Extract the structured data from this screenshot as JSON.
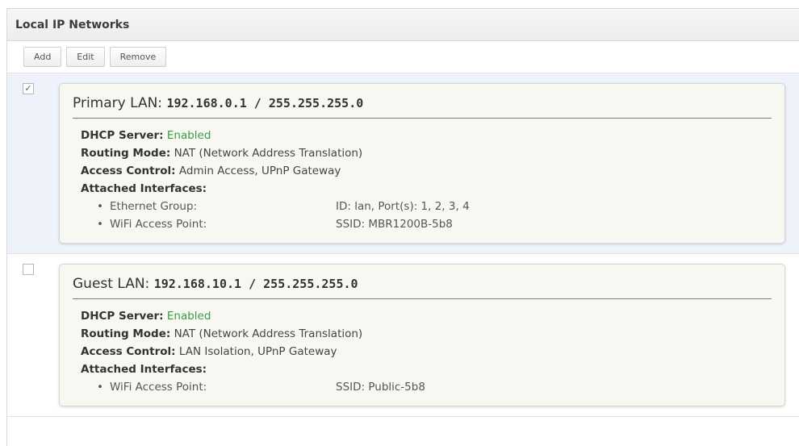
{
  "panel": {
    "title": "Local IP Networks"
  },
  "toolbar": {
    "add_label": "Add",
    "edit_label": "Edit",
    "remove_label": "Remove"
  },
  "networks": [
    {
      "selected": true,
      "check_glyph": "✓",
      "name": "Primary LAN:",
      "address": "192.168.0.1 / 255.255.255.0",
      "dhcp_label": "DHCP Server:",
      "dhcp_value": "Enabled",
      "routing_label": "Routing Mode:",
      "routing_value": "NAT (Network Address Translation)",
      "access_label": "Access Control:",
      "access_value": "Admin Access, UPnP Gateway",
      "interfaces_label": "Attached Interfaces:",
      "interfaces": [
        {
          "name": "Ethernet Group:",
          "detail": "ID: lan, Port(s): 1, 2, 3, 4"
        },
        {
          "name": "WiFi Access Point:",
          "detail": "SSID: MBR1200B-5b8"
        }
      ]
    },
    {
      "selected": false,
      "check_glyph": "",
      "name": "Guest LAN:",
      "address": "192.168.10.1 / 255.255.255.0",
      "dhcp_label": "DHCP Server:",
      "dhcp_value": "Enabled",
      "routing_label": "Routing Mode:",
      "routing_value": "NAT (Network Address Translation)",
      "access_label": "Access Control:",
      "access_value": "LAN Isolation, UPnP Gateway",
      "interfaces_label": "Attached Interfaces:",
      "interfaces": [
        {
          "name": "WiFi Access Point:",
          "detail": "SSID: Public-5b8"
        }
      ]
    }
  ],
  "colors": {
    "enabled": "#3a9a45",
    "selected_row": "#eef3fb"
  }
}
